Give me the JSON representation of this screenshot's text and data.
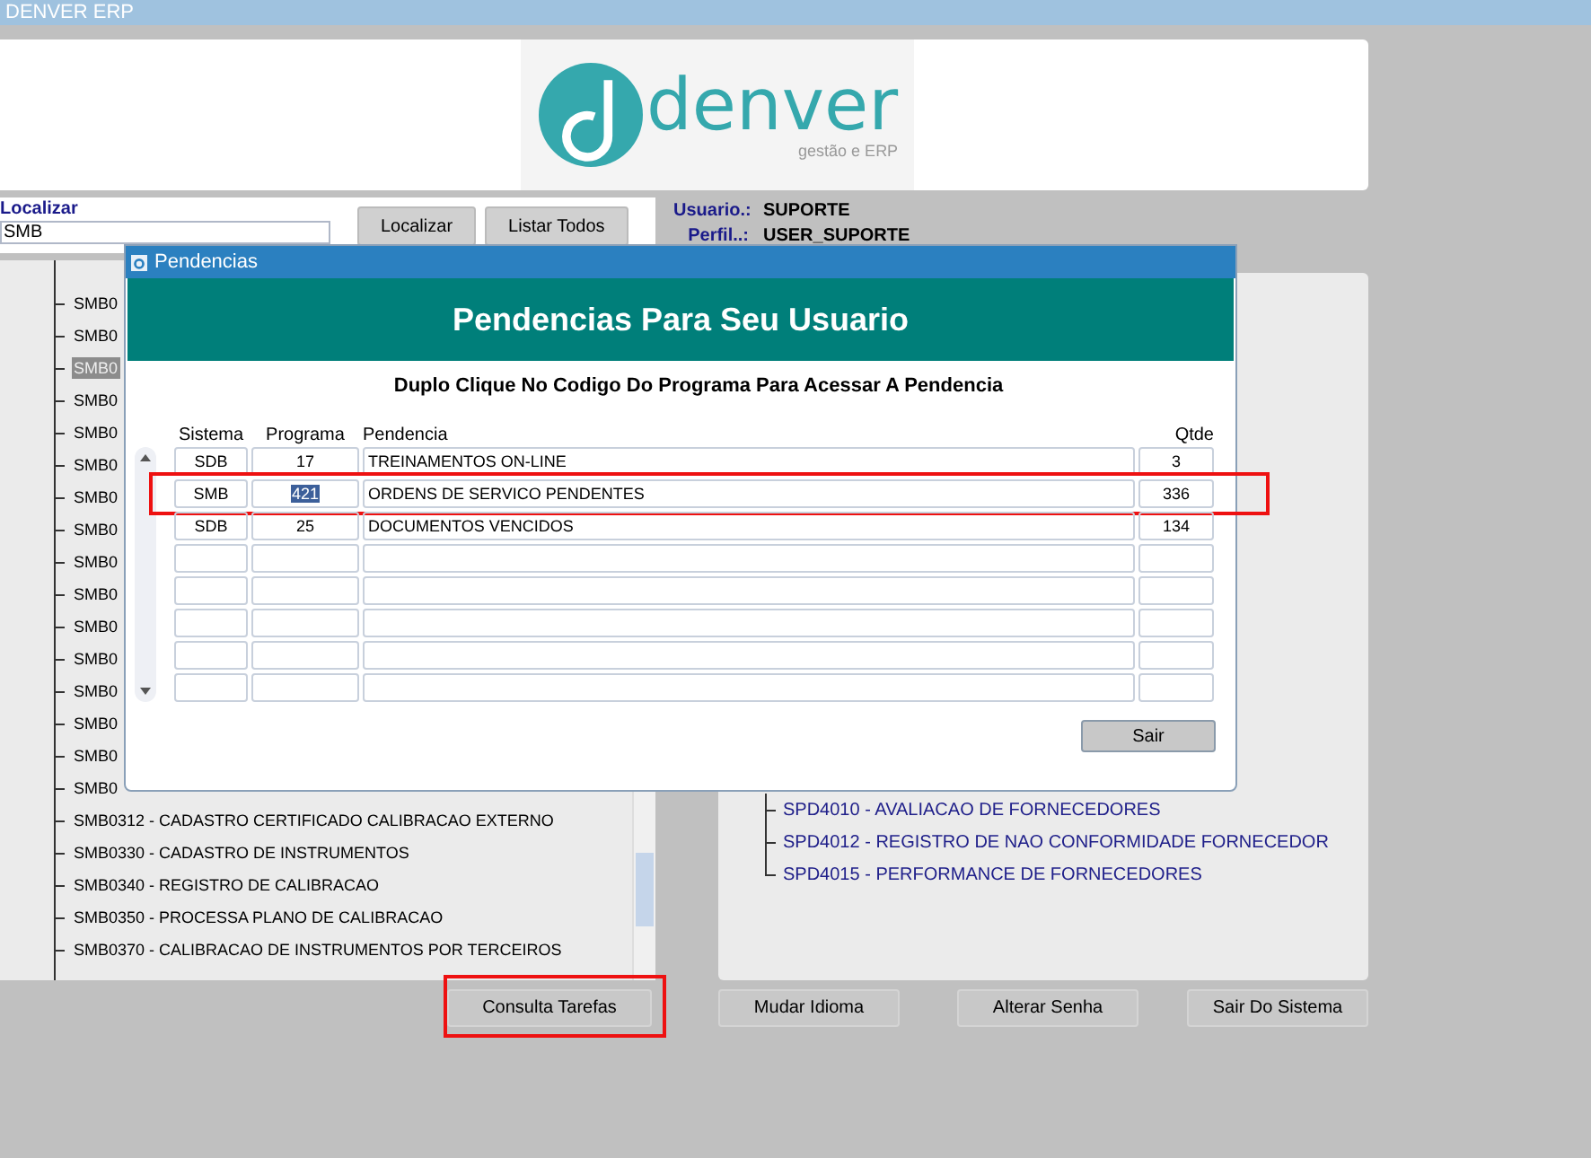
{
  "window": {
    "title": "DENVER ERP"
  },
  "logo": {
    "wordmark": "denver",
    "tagline": "gestão e ERP"
  },
  "search": {
    "label": "Localizar",
    "value": "SMB",
    "buttons": [
      "Localizar",
      "Listar Todos"
    ]
  },
  "user": [
    {
      "label": "Usuario.:",
      "value": "SUPORTE"
    },
    {
      "label": "Perfil..:",
      "value": "USER_SUPORTE"
    }
  ],
  "program_tree": [
    {
      "label": "SMB0",
      "selected": false
    },
    {
      "label": "SMB0",
      "selected": false
    },
    {
      "label": "SMB0",
      "selected": true
    },
    {
      "label": "SMB0",
      "selected": false
    },
    {
      "label": "SMB0",
      "selected": false
    },
    {
      "label": "SMB0",
      "selected": false
    },
    {
      "label": "SMB0",
      "selected": false
    },
    {
      "label": "SMB0",
      "selected": false
    },
    {
      "label": "SMB0",
      "selected": false
    },
    {
      "label": "SMB0",
      "selected": false
    },
    {
      "label": "SMB0",
      "selected": false
    },
    {
      "label": "SMB0",
      "selected": false
    },
    {
      "label": "SMB0",
      "selected": false
    },
    {
      "label": "SMB0",
      "selected": false
    },
    {
      "label": "SMB0",
      "selected": false
    },
    {
      "label": "SMB0",
      "selected": false
    },
    {
      "label": "SMB0312 - CADASTRO CERTIFICADO CALIBRACAO EXTERNO",
      "selected": false
    },
    {
      "label": "SMB0330 - CADASTRO DE INSTRUMENTOS",
      "selected": false
    },
    {
      "label": "SMB0340 - REGISTRO DE CALIBRACAO",
      "selected": false
    },
    {
      "label": "SMB0350 - PROCESSA PLANO DE CALIBRACAO",
      "selected": false
    },
    {
      "label": "SMB0370 - CALIBRACAO DE INSTRUMENTOS POR TERCEIROS",
      "selected": false
    }
  ],
  "module_tree": [
    {
      "label": "SPD4010 - AVALIACAO DE FORNECEDORES"
    },
    {
      "label": "SPD4012 - REGISTRO DE NAO CONFORMIDADE FORNECEDOR"
    },
    {
      "label": "SPD4015 - PERFORMANCE DE FORNECEDORES"
    }
  ],
  "bottom_buttons": [
    {
      "label": "Consulta Tarefas",
      "highlighted": true
    },
    {
      "label": "Mudar Idioma",
      "highlighted": false
    },
    {
      "label": "Alterar Senha",
      "highlighted": false
    },
    {
      "label": "Sair Do Sistema",
      "highlighted": false
    }
  ],
  "dialog": {
    "title": "Pendencias",
    "heading": "Pendencias Para Seu Usuario",
    "instruction": "Duplo Clique No Codigo Do Programa Para Acessar A Pendencia",
    "columns": [
      "Sistema",
      "Programa",
      "Pendencia",
      "Qtde"
    ],
    "rows": [
      {
        "cells": [
          "SDB",
          "17",
          "TREINAMENTOS ON-LINE",
          "3"
        ],
        "selected": false,
        "highlighted": false
      },
      {
        "cells": [
          "SMB",
          "421",
          "ORDENS DE SERVICO PENDENTES",
          "336"
        ],
        "selected": true,
        "highlighted": true
      },
      {
        "cells": [
          "SDB",
          "25",
          "DOCUMENTOS VENCIDOS",
          "134"
        ],
        "selected": false,
        "highlighted": false
      }
    ],
    "close_button": "Sair"
  }
}
